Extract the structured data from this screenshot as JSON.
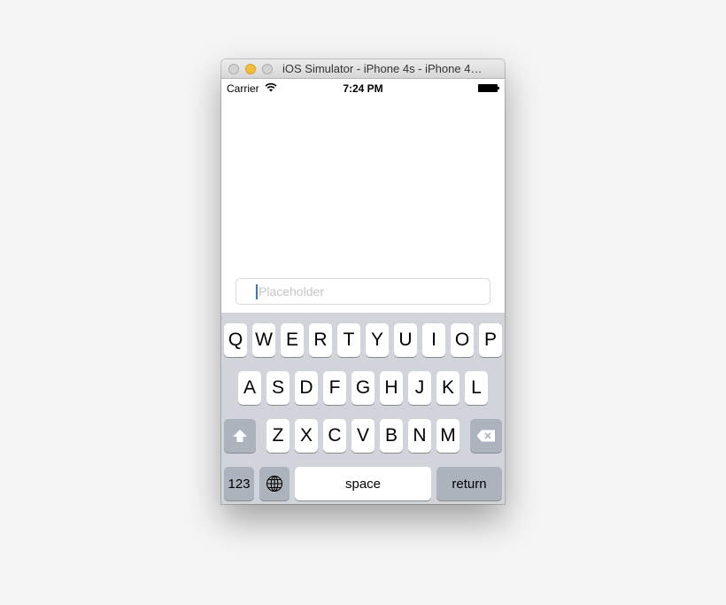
{
  "window": {
    "title": "iOS Simulator - iPhone 4s - iPhone 4…"
  },
  "status_bar": {
    "carrier": "Carrier",
    "time": "7:24 PM"
  },
  "text_field": {
    "placeholder": "Placeholder"
  },
  "keyboard": {
    "row1": [
      "Q",
      "W",
      "E",
      "R",
      "T",
      "Y",
      "U",
      "I",
      "O",
      "P"
    ],
    "row2": [
      "A",
      "S",
      "D",
      "F",
      "G",
      "H",
      "J",
      "K",
      "L"
    ],
    "row3": [
      "Z",
      "X",
      "C",
      "V",
      "B",
      "N",
      "M"
    ],
    "numbers_label": "123",
    "space_label": "space",
    "return_label": "return"
  },
  "icons": {
    "wifi": "wifi-icon",
    "battery": "battery-icon",
    "shift": "shift-icon",
    "delete": "delete-icon",
    "globe": "globe-icon"
  }
}
